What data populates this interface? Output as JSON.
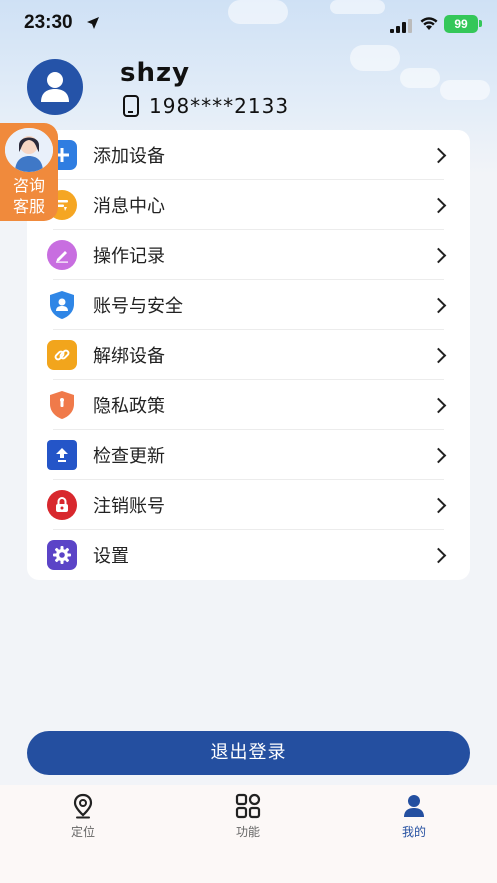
{
  "status_bar": {
    "time": "23:30",
    "battery": "99"
  },
  "profile": {
    "username": "shzy",
    "phone": "198****2133"
  },
  "support": {
    "label": "咨询\n客服"
  },
  "menu": {
    "items": [
      {
        "label": "添加设备",
        "icon": "plus-icon",
        "color": "#2f7de1"
      },
      {
        "label": "消息中心",
        "icon": "message-icon",
        "color": "#f5a623"
      },
      {
        "label": "操作记录",
        "icon": "pencil-icon",
        "color": "#c86ee0"
      },
      {
        "label": "账号与安全",
        "icon": "shield-user-icon",
        "color": "#2f86e6"
      },
      {
        "label": "解绑设备",
        "icon": "link-icon",
        "color": "#f2a51c"
      },
      {
        "label": "隐私政策",
        "icon": "privacy-shield-icon",
        "color": "#f07a4a"
      },
      {
        "label": "检查更新",
        "icon": "update-arrow-icon",
        "color": "#2455c8"
      },
      {
        "label": "注销账号",
        "icon": "lock-icon",
        "color": "#d8282e"
      },
      {
        "label": "设置",
        "icon": "gear-icon",
        "color": "#5b44c7"
      }
    ]
  },
  "logout_label": "退出登录",
  "tabbar": {
    "tabs": [
      {
        "label": "定位",
        "icon": "location-pin-icon",
        "active": false
      },
      {
        "label": "功能",
        "icon": "grid-icon",
        "active": false
      },
      {
        "label": "我的",
        "icon": "person-icon",
        "active": true
      }
    ]
  },
  "colors": {
    "accent": "#244fa0",
    "support": "#f08a3c"
  }
}
